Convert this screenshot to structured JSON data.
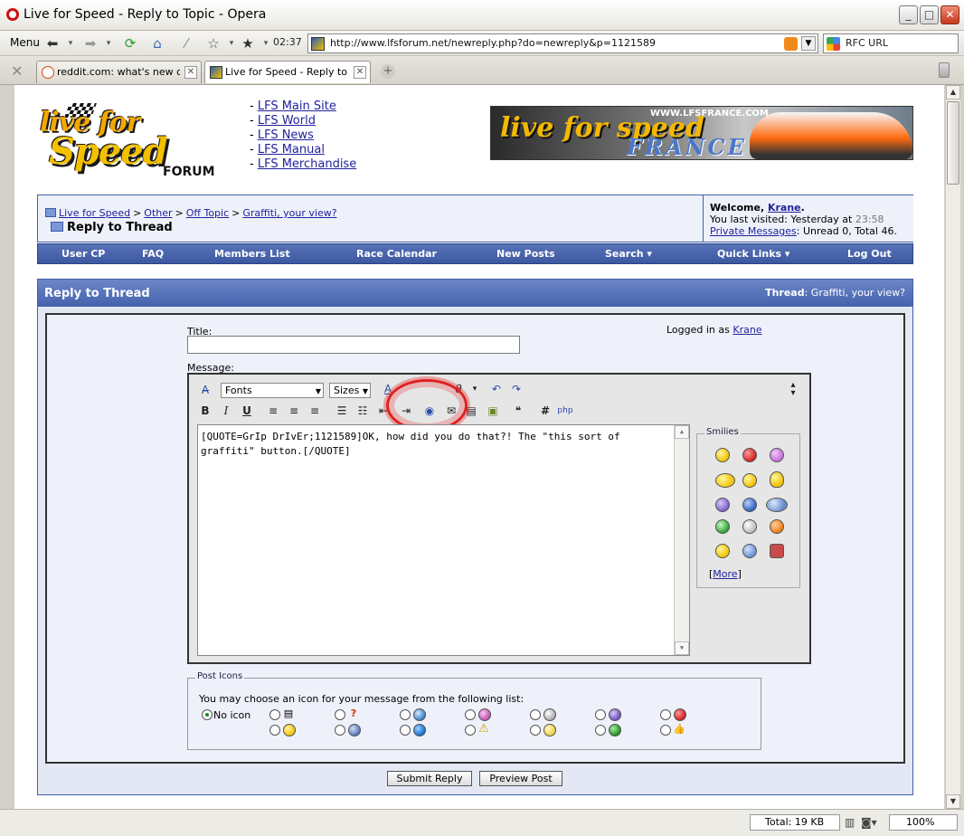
{
  "window": {
    "title": "Live for Speed - Reply to Topic - Opera",
    "min": "_",
    "max": "□",
    "close": "✕"
  },
  "toolbar": {
    "menu": "Menu",
    "time": "02:37",
    "url": "http://www.lfsforum.net/newreply.php?do=newreply&p=1121589",
    "search_engine": "RFC URL"
  },
  "tabs": [
    {
      "label": "reddit.com: what's new on...",
      "active": false
    },
    {
      "label": "Live for Speed - Reply to T...",
      "active": true
    }
  ],
  "logo": {
    "line1": "live for",
    "line2": "Speed",
    "sub": "FORUM"
  },
  "toplinks": [
    "LFS Main Site",
    "LFS World",
    "LFS News",
    "LFS Manual",
    "LFS Merchandise"
  ],
  "banner": {
    "site": "WWW.LFSFRANCE.COM",
    "text": "live for speed",
    "country": "FRANCE"
  },
  "breadcrumb": {
    "items": [
      "Live for Speed",
      "Other",
      "Off Topic",
      "Graffiti, your view?"
    ],
    "current": "Reply to Thread"
  },
  "welcome": {
    "prefix": "Welcome, ",
    "user": "Krane",
    "last_visit_prefix": "You last visited: Yesterday at ",
    "last_visit_time": "23:58",
    "pm_link": "Private Messages",
    "pm_status": ": Unread 0, Total 46."
  },
  "nav": [
    "User CP",
    "FAQ",
    "Members List",
    "Race Calendar",
    "New Posts",
    "Search ▾",
    "Quick Links ▾",
    "Log Out"
  ],
  "panel": {
    "title": "Reply to Thread",
    "thread_label": "Thread",
    "thread_name": ": Graffiti, your view?"
  },
  "form": {
    "title_label": "Title:",
    "title_value": "",
    "message_label": "Message:",
    "logged_in_prefix": "Logged in as ",
    "logged_in_user": "Krane",
    "font_select": "Fonts",
    "size_select": "Sizes",
    "message": "[QUOTE=GrIp DrIvEr;1121589]OK, how did you do that?! The \"this sort of graffiti\" button.[/QUOTE]"
  },
  "smilies": {
    "legend": "Smilies",
    "more": "More"
  },
  "post_icons": {
    "legend": "Post Icons",
    "description": "You may choose an icon for your message from the following list:",
    "no_icon": "No icon"
  },
  "buttons": {
    "submit": "Submit Reply",
    "preview": "Preview Post"
  },
  "status": {
    "total": "Total:   19 KB",
    "zoom": "100%"
  }
}
